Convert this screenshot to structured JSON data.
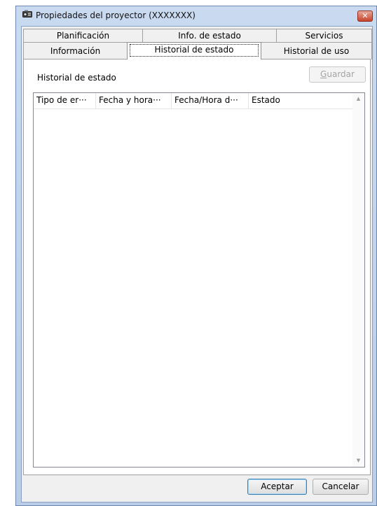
{
  "window": {
    "title": "Propiedades del proyector (XXXXXXX)",
    "close_glyph": "✕",
    "icon": "projector-icon"
  },
  "tabs": {
    "row1": [
      {
        "label": "Planificación"
      },
      {
        "label": "Info. de estado"
      },
      {
        "label": "Servicios"
      }
    ],
    "row2": [
      {
        "label": "Información"
      },
      {
        "label": "Historial de estado",
        "active": true
      },
      {
        "label": "Historial de uso"
      }
    ]
  },
  "panel": {
    "section_label": "Historial de estado",
    "save_prefix": "",
    "save_mnemonic": "G",
    "save_rest": "uardar",
    "save_enabled": false
  },
  "list": {
    "columns": [
      {
        "label": "Tipo de er···"
      },
      {
        "label": "Fecha y hora···"
      },
      {
        "label": "Fecha/Hora d···"
      },
      {
        "label": "Estado"
      }
    ],
    "rows": []
  },
  "footer": {
    "ok_label": "Aceptar",
    "cancel_label": "Cancelar"
  },
  "colors": {
    "window_frame": "#b9cde9",
    "close_button": "#c7432b",
    "default_button_border": "#3c7fb1"
  }
}
